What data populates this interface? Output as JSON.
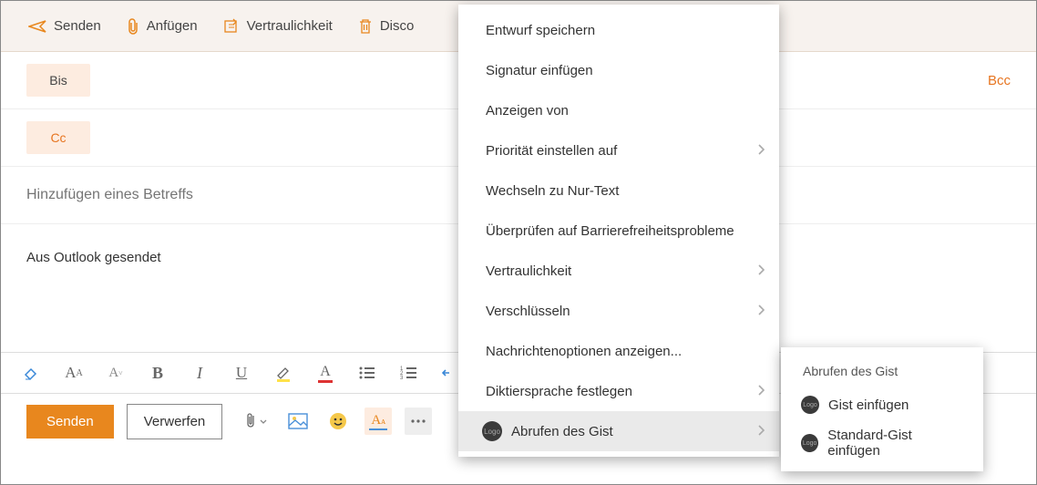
{
  "toolbar": {
    "send": "Senden",
    "attach": "Anfügen",
    "confidentiality": "Vertraulichkeit",
    "discard_partial": "Disco"
  },
  "fields": {
    "to_label": "Bis",
    "cc_label": "Cc",
    "bcc_label": "Bcc",
    "subject_placeholder": "Hinzufügen eines Betreffs"
  },
  "body": {
    "signature": "Aus Outlook gesendet"
  },
  "bottom": {
    "send": "Senden",
    "discard": "Verwerfen"
  },
  "menu": {
    "items": [
      {
        "label": "Entwurf speichern",
        "submenu": false
      },
      {
        "label": "Signatur einfügen",
        "submenu": false
      },
      {
        "label": "Anzeigen von",
        "submenu": false
      },
      {
        "label": "Priorität einstellen auf",
        "submenu": true
      },
      {
        "label": "Wechseln zu Nur-Text",
        "submenu": false
      },
      {
        "label": "Überprüfen auf Barrierefreiheitsprobleme",
        "submenu": false
      },
      {
        "label": "Vertraulichkeit",
        "submenu": true
      },
      {
        "label": "Verschlüsseln",
        "submenu": true
      },
      {
        "label": "Nachrichtenoptionen anzeigen...",
        "submenu": false
      },
      {
        "label": "Diktiersprache festlegen",
        "submenu": true
      },
      {
        "label": "Abrufen des Gist",
        "submenu": true,
        "icon": true,
        "highlighted": true
      }
    ]
  },
  "submenu": {
    "title": "Abrufen des Gist",
    "items": [
      {
        "label": "Gist einfügen"
      },
      {
        "label": "Standard-Gist einfügen"
      }
    ]
  },
  "colors": {
    "accent": "#e8871e",
    "chip_bg": "#fdece0"
  }
}
